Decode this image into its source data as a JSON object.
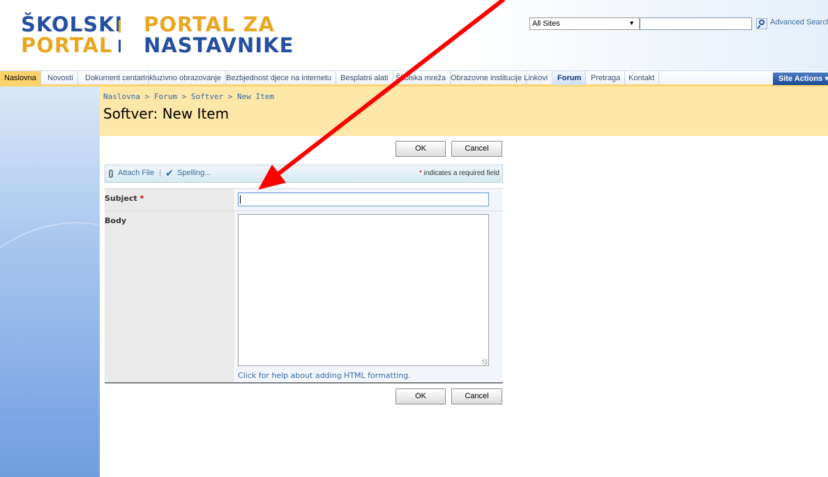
{
  "header": {
    "logo": {
      "line1": "ŠKOLSKI",
      "line2": "PORTAL",
      "line3": "PORTAL ZA",
      "line4": "NASTAVNIKE"
    },
    "search": {
      "scope": "All Sites",
      "query": "",
      "advanced_label": "Advanced Search"
    }
  },
  "nav": {
    "tabs": [
      {
        "label": "Naslovna"
      },
      {
        "label": "Novosti"
      },
      {
        "label": "Dokument centar"
      },
      {
        "label": "Inkluzivno obrazovanje"
      },
      {
        "label": "Bezbjednost djece na internetu"
      },
      {
        "label": "Besplatni alati"
      },
      {
        "label": "Školska mreža"
      },
      {
        "label": "Obrazovne institucije"
      },
      {
        "label": "Linkovi"
      },
      {
        "label": "Forum"
      },
      {
        "label": "Pretraga"
      },
      {
        "label": "Kontakt"
      }
    ],
    "active": "Forum",
    "site_actions": "Site Actions ▾"
  },
  "page": {
    "breadcrumb": "Naslovna > Forum > Softver > New Item",
    "title": "Softver: New Item"
  },
  "toolbar": {
    "ok_label": "OK",
    "cancel_label": "Cancel",
    "attach_label": "Attach File",
    "separator": "|",
    "spelling_label": "Spelling...",
    "required_star": "*",
    "required_note": "indicates a required field"
  },
  "form": {
    "subject_label": "Subject",
    "subject_required": "*",
    "subject_value": "",
    "body_label": "Body",
    "body_value": "",
    "help_link": "Click for help about adding HTML formatting."
  },
  "colors": {
    "nav_accent": "#fcd36b",
    "title_band": "#fde7a9",
    "link": "#3b6aa0",
    "annotation_arrow": "#ff0000"
  }
}
